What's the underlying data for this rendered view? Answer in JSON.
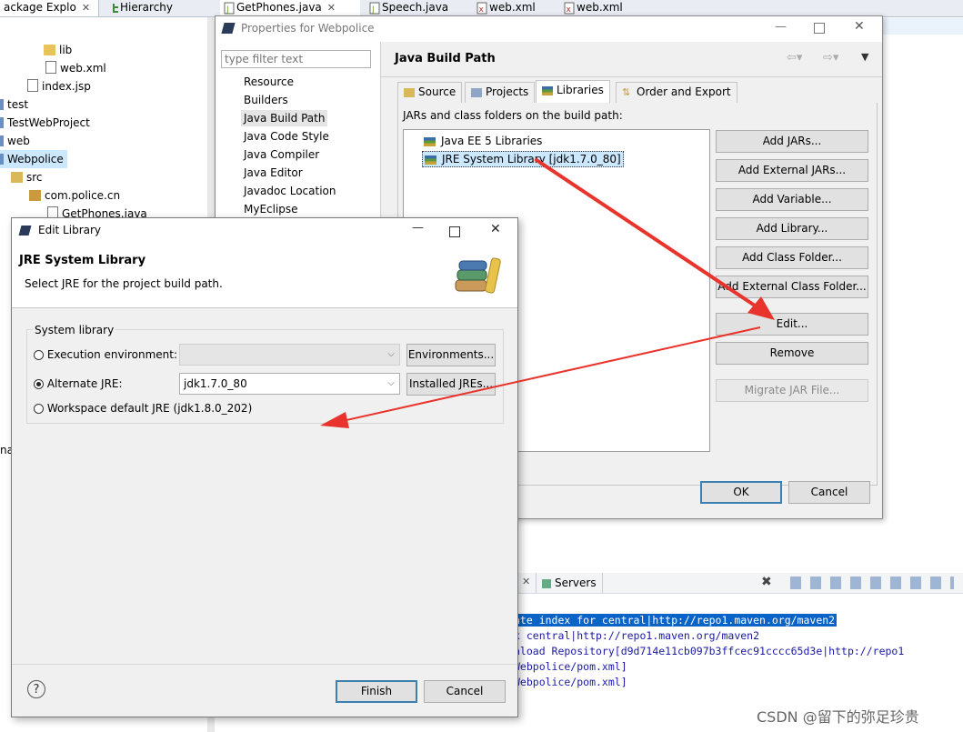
{
  "eclipse": {
    "tabs": [
      "ackage Explo",
      "Hierarchy",
      "GetPhones.java",
      "Speech.java",
      "web.xml",
      "web.xml"
    ],
    "tree": [
      "lib",
      "web.xml",
      "index.jsp",
      "test",
      "TestWebProject",
      "web",
      "Webpolice",
      "src",
      "com.police.cn",
      "GetPhones.java"
    ],
    "side_fragment": "na",
    "console": {
      "servers_tab": "Servers",
      "lines": [
        "ate index for central|http://repo1.maven.org/maven2",
        "x central|http://repo1.maven.org/maven2",
        "nload Repository[d9d714e11cb097b3ffcec91cccc65d3e|http://repo1",
        "Webpolice/pom.xml]",
        "Webpolice/pom.xml]"
      ]
    }
  },
  "properties": {
    "title": "Properties for Webpolice",
    "filter_placeholder": "type filter text",
    "nav": [
      "Resource",
      "Builders",
      "Java Build Path",
      "Java Code Style",
      "Java Compiler",
      "Java Editor",
      "Javadoc Location",
      "MyEclipse"
    ],
    "page_title": "Java Build Path",
    "tabs": [
      "Source",
      "Projects",
      "Libraries",
      "Order and Export"
    ],
    "list_label": "JARs and class folders on the build path:",
    "entries": [
      "Java EE 5 Libraries",
      "JRE System Library [jdk1.7.0_80]"
    ],
    "buttons": [
      "Add JARs...",
      "Add External JARs...",
      "Add Variable...",
      "Add Library...",
      "Add Class Folder...",
      "Add External Class Folder...",
      "Edit...",
      "Remove",
      "Migrate JAR File..."
    ],
    "ok": "OK",
    "cancel": "Cancel"
  },
  "edit_library": {
    "title": "Edit Library",
    "heading": "JRE System Library",
    "description": "Select JRE for the project build path.",
    "group_label": "System library",
    "opt_exec": "Execution environment:",
    "opt_alt": "Alternate JRE:",
    "opt_workspace": "Workspace default JRE (jdk1.8.0_202)",
    "alt_value": "jdk1.7.0_80",
    "environments_btn": "Environments...",
    "installed_btn": "Installed JREs...",
    "finish": "Finish",
    "cancel": "Cancel"
  },
  "watermark": "CSDN @留下的弥足珍贵",
  "colors": {
    "arrow": "#e8342c",
    "selection": "#cce8ff",
    "console_text": "#1a1aa6",
    "console_highlight": "#0a64c8"
  }
}
